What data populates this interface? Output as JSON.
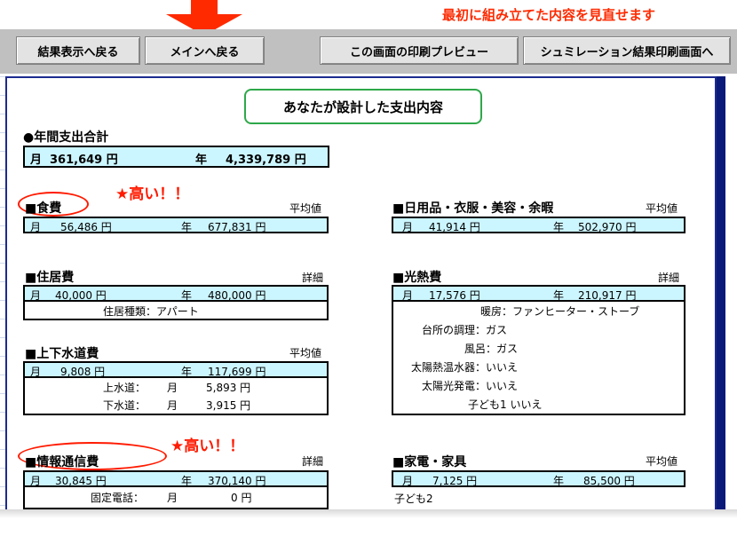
{
  "annotation": {
    "top_note": "最初に組み立てた内容を見直せます",
    "callout_food": "★高い！！",
    "callout_info": "★高い！！"
  },
  "toolbar": {
    "back_to_results": "結果表示へ戻る",
    "back_to_main": "メインへ戻る",
    "print_preview": "この画面の印刷プレビュー",
    "print_results": "シュミレーション結果印刷画面へ"
  },
  "report": {
    "title": "あなたが設計した支出内容",
    "annual_total": {
      "heading": "●年間支出合計",
      "month_label": "月",
      "month_value": "361,649 円",
      "year_label": "年",
      "year_value": "4,339,789 円"
    },
    "food": {
      "heading": "■食費",
      "note": "平均値",
      "month_label": "月",
      "month_value": "56,486 円",
      "year_label": "年",
      "year_value": "677,831 円"
    },
    "daily": {
      "heading": "■日用品・衣服・美容・余暇",
      "note": "平均値",
      "month_label": "月",
      "month_value": "41,914 円",
      "year_label": "年",
      "year_value": "502,970 円"
    },
    "housing": {
      "heading": "■住居費",
      "note": "詳細",
      "month_label": "月",
      "month_value": "40,000 円",
      "year_label": "年",
      "year_value": "480,000 円",
      "detail": "住居種類：アパート"
    },
    "utilities": {
      "heading": "■光熱費",
      "note": "詳細",
      "month_label": "月",
      "month_value": "17,576 円",
      "year_label": "年",
      "year_value": "210,917 円",
      "details": [
        "暖房：ファンヒーター・ストーブ",
        "台所の調理：ガス",
        "風呂：ガス",
        "太陽熱温水器：いいえ",
        "太陽光発電：いいえ",
        "子ども1 いいえ"
      ]
    },
    "water": {
      "heading": "■上下水道費",
      "note": "平均値",
      "month_label": "月",
      "month_value": "9,808 円",
      "year_label": "年",
      "year_value": "117,699 円",
      "supply_label": "上水道：",
      "supply_month": "月",
      "supply_value": "5,893 円",
      "sewer_label": "下水道：",
      "sewer_month": "月",
      "sewer_value": "3,915 円"
    },
    "info": {
      "heading": "■情報通信費",
      "note": "詳細",
      "month_label": "月",
      "month_value": "30,845 円",
      "year_label": "年",
      "year_value": "370,140 円",
      "phone_label": "固定電話：",
      "phone_month": "月",
      "phone_value": "0 円"
    },
    "appliances": {
      "heading": "■家電・家具",
      "note": "平均値",
      "month_label": "月",
      "month_value": "7,125 円",
      "year_label": "年",
      "year_value": "85,500 円",
      "child_note": "子ども2"
    }
  },
  "colors": {
    "highlight_red": "#ff1a00",
    "row_cyan": "#ccf6ff",
    "title_border_green": "#2ea84a",
    "frame_blue": "#1c2a8f"
  }
}
